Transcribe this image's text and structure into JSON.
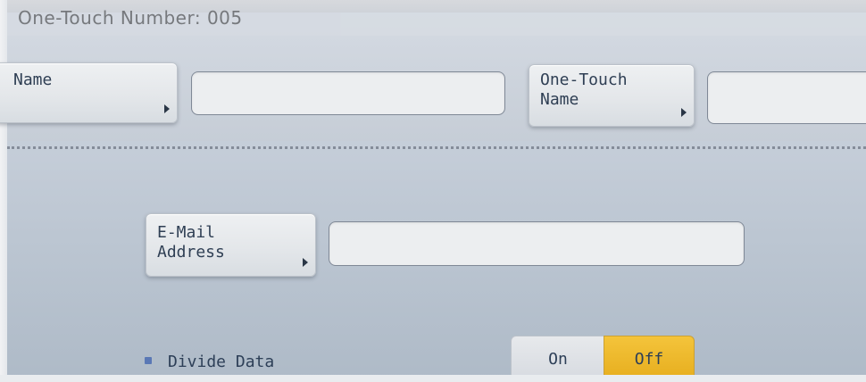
{
  "header": {
    "onetouch_number_text": "One-Touch Number: 005"
  },
  "fields": {
    "name": {
      "label": "Name",
      "value": ""
    },
    "one_touch_name": {
      "label": "One-Touch\nName",
      "value": ""
    },
    "email_address": {
      "label": "E-Mail\nAddress",
      "value": ""
    }
  },
  "divide_data": {
    "label": "Divide Data",
    "on_label": "On",
    "off_label": "Off",
    "selected": "Off",
    "accent_selected": "#f0b52b",
    "bullet_color": "#5a78b5"
  },
  "icons": {
    "button_indicator": "triangle-right-icon"
  }
}
